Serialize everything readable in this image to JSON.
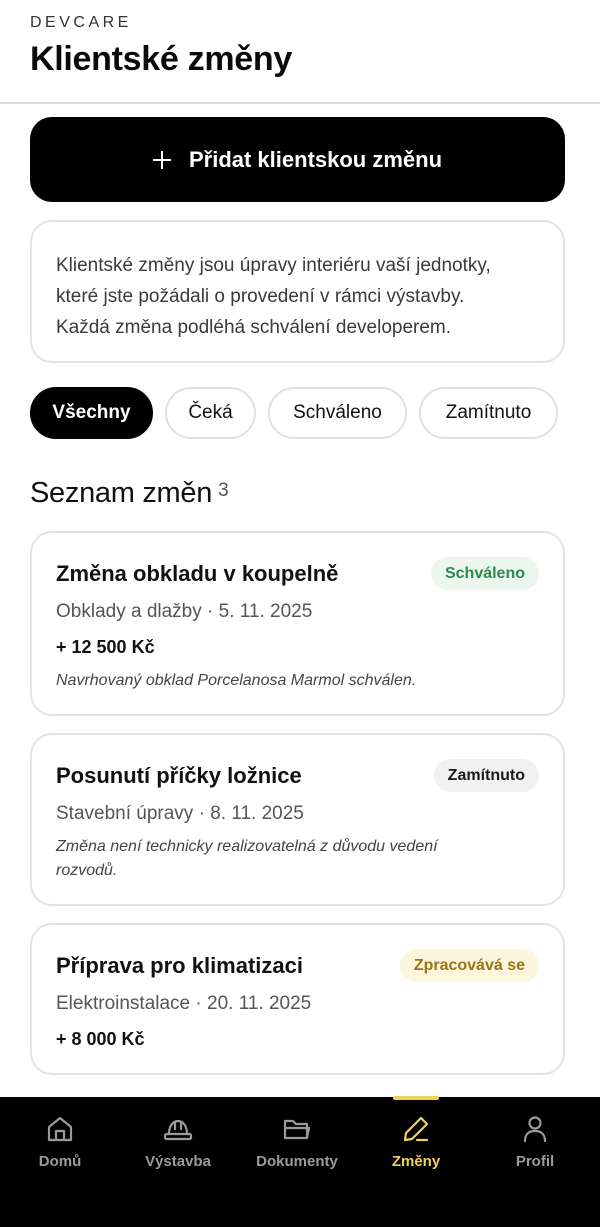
{
  "header": {
    "brand": "DEVCARE",
    "title": "Klientské změny"
  },
  "add_button": {
    "label": "Přidat klientskou změnu",
    "icon": "plus-icon"
  },
  "info": {
    "lines": [
      "Klientské změny jsou úpravy interiéru vaší jednotky,",
      "které jste požádali o provedení v rámci výstavby.",
      "Každá změna podléhá schválení developerem."
    ]
  },
  "filters": [
    {
      "label": "Všechny",
      "active": true
    },
    {
      "label": "Čeká",
      "active": false
    },
    {
      "label": "Schváleno",
      "active": false
    },
    {
      "label": "Zamítnuto",
      "active": false
    }
  ],
  "list": {
    "title": "Seznam změn",
    "count": "3"
  },
  "changes": [
    {
      "title": "Změna obkladu v koupelně",
      "status": "Schváleno",
      "status_color": "#2f8a4e",
      "meta": "Obklady a dlažby · 5. 11. 2025",
      "price": "+ 12 500 Kč",
      "note": "Navrhovaný obklad Porcelanosa Marmol schválen."
    },
    {
      "title": "Posunutí příčky ložnice",
      "status": "Zamítnuto",
      "status_color": "#1a1a1a",
      "meta": "Stavební úpravy · 8. 11. 2025",
      "note_lines": [
        "Změna není technicky realizovatelná z důvodu vedení",
        "rozvodů."
      ]
    },
    {
      "title": "Příprava pro klimatizaci",
      "status": "Zpracovává se",
      "status_color": "#9a7414",
      "meta": "Elektroinstalace · 20. 11. 2025",
      "price": "+ 8 000 Kč"
    }
  ],
  "tabbar": {
    "accent": "#f2d15a",
    "items": [
      {
        "label": "Domů",
        "icon": "home-icon"
      },
      {
        "label": "Výstavba",
        "icon": "hard-hat-icon"
      },
      {
        "label": "Dokumenty",
        "icon": "folder-icon"
      },
      {
        "label": "Změny",
        "icon": "pencil-icon",
        "active": true
      },
      {
        "label": "Profil",
        "icon": "user-icon"
      }
    ]
  }
}
